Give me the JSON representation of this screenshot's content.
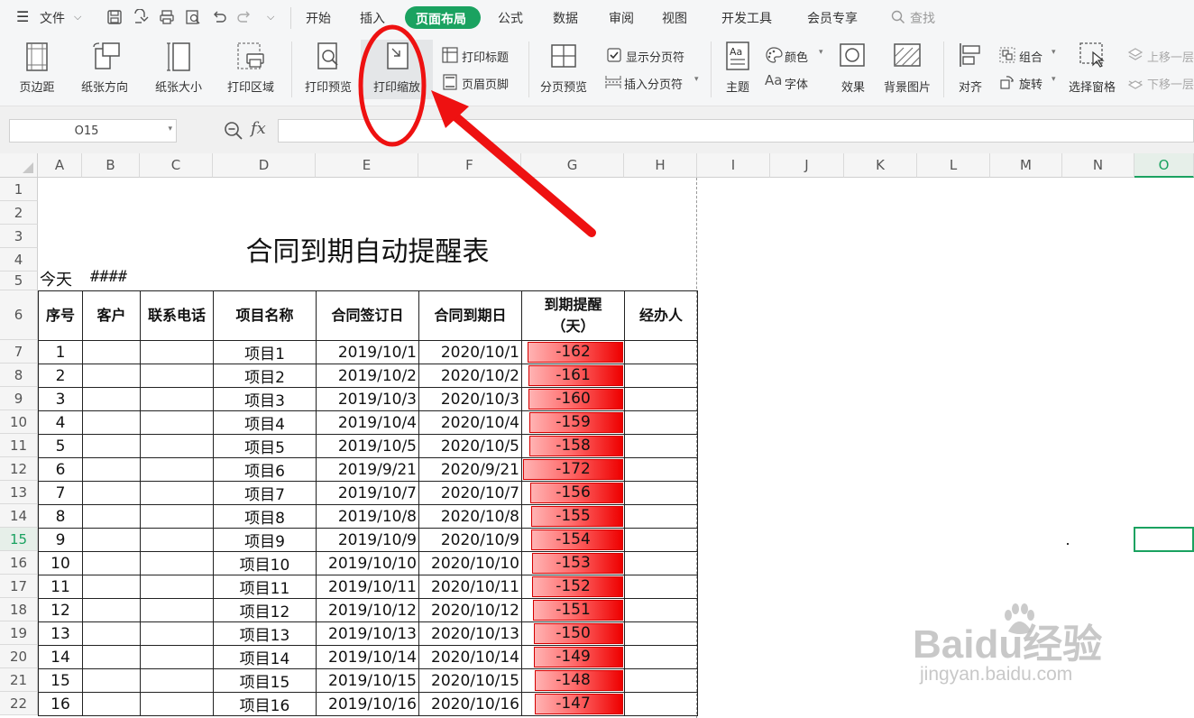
{
  "menubar": {
    "file_label": "文件",
    "tabs": [
      {
        "label": "开始"
      },
      {
        "label": "插入"
      },
      {
        "label": "页面布局"
      },
      {
        "label": "公式"
      },
      {
        "label": "数据"
      },
      {
        "label": "审阅"
      },
      {
        "label": "视图"
      },
      {
        "label": "开发工具"
      },
      {
        "label": "会员专享"
      }
    ],
    "search_label": "查找",
    "accent_color": "#1aa260"
  },
  "ribbon": {
    "margins": "页边距",
    "orientation": "纸张方向",
    "size": "纸张大小",
    "print_area": "打印区域",
    "print_preview": "打印预览",
    "print_scale": "打印缩放",
    "print_titles": "打印标题",
    "header_footer": "页眉页脚",
    "page_break_preview": "分页预览",
    "show_page_breaks": "显示分页符",
    "insert_page_break": "插入分页符",
    "theme": "主题",
    "colors": "颜色",
    "fonts": "字体",
    "effects": "效果",
    "background": "背景图片",
    "align": "对齐",
    "group": "组合",
    "rotate": "旋转",
    "selection_pane": "选择窗格",
    "bring_forward": "上移一层",
    "send_backward": "下移一层"
  },
  "formula_bar": {
    "name_box": "O15",
    "fx": "fx",
    "value": ""
  },
  "sheet": {
    "columns": [
      "A",
      "B",
      "C",
      "D",
      "E",
      "F",
      "G",
      "H",
      "I",
      "J",
      "K",
      "L",
      "M",
      "N",
      "O"
    ],
    "rows": [
      "1",
      "2",
      "3",
      "4",
      "5",
      "6",
      "7",
      "8",
      "9",
      "10",
      "11",
      "12",
      "13",
      "14",
      "15",
      "16",
      "17",
      "18",
      "19",
      "20",
      "21",
      "22"
    ],
    "active_column": "O",
    "active_row": "15",
    "title": "合同到期自动提醒表",
    "today_label": "今天",
    "today_value": "####",
    "headers": {
      "seq": "序号",
      "customer": "客户",
      "phone": "联系电话",
      "project": "项目名称",
      "sign_date": "合同签订日",
      "expire_date": "合同到期日",
      "remind": "到期提醒（天）",
      "handler": "经办人"
    },
    "records": [
      {
        "seq": "1",
        "customer": "",
        "phone": "",
        "project": "项目1",
        "sign": "2019/10/1",
        "expire": "2020/10/1",
        "days": "-162",
        "days_num": -162,
        "handler": ""
      },
      {
        "seq": "2",
        "customer": "",
        "phone": "",
        "project": "项目2",
        "sign": "2019/10/2",
        "expire": "2020/10/2",
        "days": "-161",
        "days_num": -161,
        "handler": ""
      },
      {
        "seq": "3",
        "customer": "",
        "phone": "",
        "project": "项目3",
        "sign": "2019/10/3",
        "expire": "2020/10/3",
        "days": "-160",
        "days_num": -160,
        "handler": ""
      },
      {
        "seq": "4",
        "customer": "",
        "phone": "",
        "project": "项目4",
        "sign": "2019/10/4",
        "expire": "2020/10/4",
        "days": "-159",
        "days_num": -159,
        "handler": ""
      },
      {
        "seq": "5",
        "customer": "",
        "phone": "",
        "project": "项目5",
        "sign": "2019/10/5",
        "expire": "2020/10/5",
        "days": "-158",
        "days_num": -158,
        "handler": ""
      },
      {
        "seq": "6",
        "customer": "",
        "phone": "",
        "project": "项目6",
        "sign": "2019/9/21",
        "expire": "2020/9/21",
        "days": "-172",
        "days_num": -172,
        "handler": ""
      },
      {
        "seq": "7",
        "customer": "",
        "phone": "",
        "project": "项目7",
        "sign": "2019/10/7",
        "expire": "2020/10/7",
        "days": "-156",
        "days_num": -156,
        "handler": ""
      },
      {
        "seq": "8",
        "customer": "",
        "phone": "",
        "project": "项目8",
        "sign": "2019/10/8",
        "expire": "2020/10/8",
        "days": "-155",
        "days_num": -155,
        "handler": ""
      },
      {
        "seq": "9",
        "customer": "",
        "phone": "",
        "project": "项目9",
        "sign": "2019/10/9",
        "expire": "2020/10/9",
        "days": "-154",
        "days_num": -154,
        "handler": ""
      },
      {
        "seq": "10",
        "customer": "",
        "phone": "",
        "project": "项目10",
        "sign": "2019/10/10",
        "expire": "2020/10/10",
        "days": "-153",
        "days_num": -153,
        "handler": ""
      },
      {
        "seq": "11",
        "customer": "",
        "phone": "",
        "project": "项目11",
        "sign": "2019/10/11",
        "expire": "2020/10/11",
        "days": "-152",
        "days_num": -152,
        "handler": ""
      },
      {
        "seq": "12",
        "customer": "",
        "phone": "",
        "project": "项目12",
        "sign": "2019/10/12",
        "expire": "2020/10/12",
        "days": "-151",
        "days_num": -151,
        "handler": ""
      },
      {
        "seq": "13",
        "customer": "",
        "phone": "",
        "project": "项目13",
        "sign": "2019/10/13",
        "expire": "2020/10/13",
        "days": "-150",
        "days_num": -150,
        "handler": ""
      },
      {
        "seq": "14",
        "customer": "",
        "phone": "",
        "project": "项目14",
        "sign": "2019/10/14",
        "expire": "2020/10/14",
        "days": "-149",
        "days_num": -149,
        "handler": ""
      },
      {
        "seq": "15",
        "customer": "",
        "phone": "",
        "project": "项目15",
        "sign": "2019/10/15",
        "expire": "2020/10/15",
        "days": "-148",
        "days_num": -148,
        "handler": ""
      },
      {
        "seq": "16",
        "customer": "",
        "phone": "",
        "project": "项目16",
        "sign": "2019/10/16",
        "expire": "2020/10/16",
        "days": "-147",
        "days_num": -147,
        "handler": ""
      }
    ],
    "bar_color": "#ee0000",
    "selection_color": "#1aa260"
  },
  "annotation": {
    "color": "#ee1111"
  },
  "watermark": {
    "main": "Baidu经验",
    "sub": "jingyan.baidu.com"
  }
}
